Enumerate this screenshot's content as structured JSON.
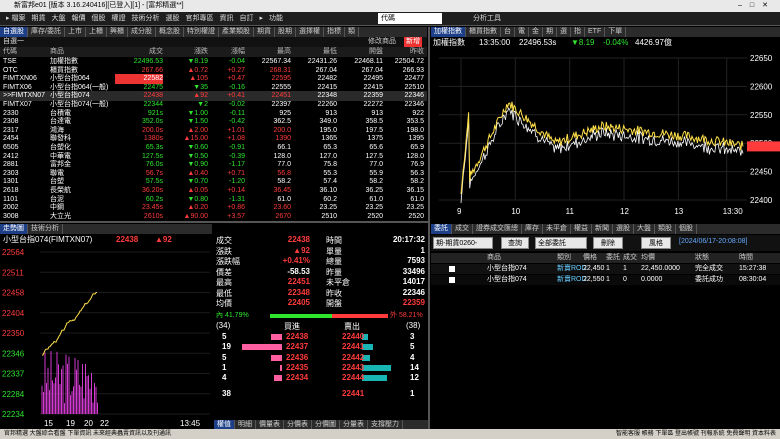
{
  "titlebar": {
    "text": "新富邦e01 [版本 3.16.240416][已登入][1] - [富邦精選**]"
  },
  "menu": {
    "items": [
      "▸ 檔案",
      "期貨",
      "大盤",
      "報價",
      "個股",
      "權證",
      "技術分析",
      "選股",
      "官邦專區",
      "資訊",
      "自訂",
      "▸",
      "功能"
    ],
    "symbol": "代碼 FIMTXN07.TF",
    "analysis": "分析工具"
  },
  "left_tabs": [
    "自選股",
    "庫存/委託",
    "上市",
    "上櫃",
    "興櫃",
    "成分股",
    "概念股",
    "特別權證",
    "產業類股",
    "期貨",
    "股期",
    "選擇權",
    "指標",
    "類"
  ],
  "sub": {
    "name": "自選一",
    "mode": "修改商品",
    "badge": "新增"
  },
  "quote_headers": [
    "代碼",
    "商品",
    "成交",
    "漲跌",
    "漲幅",
    "最高",
    "最低",
    "開盤",
    "昨收"
  ],
  "quotes": [
    {
      "code": "TSE",
      "name": "加權指數",
      "price": "22496.53",
      "chg": "▼8.19",
      "pct": "-0.04",
      "high": "22567.34",
      "low": "22431.26",
      "open": "22468.11",
      "prev": "22504.72",
      "c": "grn"
    },
    {
      "code": "OTC",
      "name": "櫃買指數",
      "price": "267.66",
      "chg": "▲0.72",
      "pct": "+0.27",
      "high": "268.31",
      "low": "267.04",
      "open": "267.04",
      "prev": "266.93",
      "c": "red"
    },
    {
      "code": "FIMTXN06",
      "name": "小型台指064",
      "price": "22582",
      "chg": "▲105",
      "pct": "+0.47",
      "high": "22595",
      "low": "22482",
      "open": "22495",
      "prev": "22477",
      "c": "red"
    },
    {
      "code": "FIMTX06",
      "name": "小型台指064(一般)",
      "price": "22475",
      "chg": "▼35",
      "pct": "-0.16",
      "high": "22555",
      "low": "22415",
      "open": "22415",
      "prev": "22510",
      "c": "grn"
    },
    {
      "code": ">>FIMTXN07",
      "name": "小型台指074",
      "price": "22438",
      "chg": "▲92",
      "pct": "+0.41",
      "high": "22451",
      "low": "22348",
      "open": "22359",
      "prev": "22346",
      "c": "red"
    },
    {
      "code": "FIMTX07",
      "name": "小型台指074(一般)",
      "price": "22344",
      "chg": "▼2",
      "pct": "-0.02",
      "high": "22397",
      "low": "22260",
      "open": "22272",
      "prev": "22346",
      "c": "grn"
    },
    {
      "code": "2330",
      "name": "台積電",
      "price": "921s",
      "chg": "▼1.00",
      "pct": "-0.11",
      "high": "925",
      "low": "913",
      "open": "913",
      "prev": "922",
      "c": "grn"
    },
    {
      "code": "2308",
      "name": "台達電",
      "price": "352.0s",
      "chg": "▼1.50",
      "pct": "-0.42",
      "high": "362.5",
      "low": "349.0",
      "open": "358.5",
      "prev": "353.5",
      "c": "grn"
    },
    {
      "code": "2317",
      "name": "鴻海",
      "price": "200.0s",
      "chg": "▲2.00",
      "pct": "+1.01",
      "high": "200.0",
      "low": "195.0",
      "open": "197.5",
      "prev": "198.0",
      "c": "red"
    },
    {
      "code": "2454",
      "name": "聯發科",
      "price": "1380s",
      "chg": "▲15.00",
      "pct": "+1.08",
      "high": "1390",
      "low": "1365",
      "open": "1375",
      "prev": "1395",
      "c": "red"
    },
    {
      "code": "6505",
      "name": "台塑化",
      "price": "65.3s",
      "chg": "▼0.60",
      "pct": "-0.91",
      "high": "66.1",
      "low": "65.3",
      "open": "65.6",
      "prev": "65.9",
      "c": "grn"
    },
    {
      "code": "2412",
      "name": "中華電",
      "price": "127.5s",
      "chg": "▼0.50",
      "pct": "-0.39",
      "high": "128.0",
      "low": "127.0",
      "open": "127.5",
      "prev": "128.0",
      "c": "grn"
    },
    {
      "code": "2881",
      "name": "富邦金",
      "price": "76.0s",
      "chg": "▼0.90",
      "pct": "-1.17",
      "high": "77.0",
      "low": "75.8",
      "open": "77.0",
      "prev": "76.9",
      "c": "grn"
    },
    {
      "code": "2303",
      "name": "聯電",
      "price": "56.7s",
      "chg": "▲0.40",
      "pct": "+0.71",
      "high": "56.8",
      "low": "55.3",
      "open": "55.9",
      "prev": "56.3",
      "c": "red"
    },
    {
      "code": "1301",
      "name": "台塑",
      "price": "57.5s",
      "chg": "▼0.70",
      "pct": "-1.20",
      "high": "58.2",
      "low": "57.4",
      "open": "58.2",
      "prev": "58.2",
      "c": "grn"
    },
    {
      "code": "2618",
      "name": "長榮航",
      "price": "36.20s",
      "chg": "▲0.05",
      "pct": "+0.14",
      "high": "36.45",
      "low": "36.10",
      "open": "36.25",
      "prev": "36.15",
      "c": "red"
    },
    {
      "code": "1101",
      "name": "台泥",
      "price": "60.2s",
      "chg": "▼0.80",
      "pct": "-1.31",
      "high": "61.0",
      "low": "60.2",
      "open": "61.0",
      "prev": "61.0",
      "c": "grn"
    },
    {
      "code": "2002",
      "name": "中鋼",
      "price": "23.45s",
      "chg": "▲0.20",
      "pct": "+0.86",
      "high": "23.60",
      "low": "23.25",
      "open": "23.25",
      "prev": "23.25",
      "c": "red"
    },
    {
      "code": "3008",
      "name": "大立光",
      "price": "2610s",
      "chg": "▲90.00",
      "pct": "+3.57",
      "high": "2670",
      "low": "2510",
      "open": "2520",
      "prev": "2520",
      "c": "red"
    }
  ],
  "detail_tabs": [
    "走勢圖",
    "技術分析"
  ],
  "detail": {
    "title": "小型台指074(FIMTXN07)",
    "price": "22438",
    "chg": "▲92",
    "y_labels": [
      "22564",
      "22511",
      "22458",
      "22404",
      "22350",
      "22346",
      "22337",
      "22284",
      "22234"
    ],
    "x_labels": [
      "15",
      "19",
      "20",
      "22",
      "13:45"
    ]
  },
  "stats": [
    [
      "成交",
      "22438",
      "時間",
      "20:17:32"
    ],
    [
      "漲跌",
      "▲92",
      "單量",
      "1"
    ],
    [
      "漲跌幅",
      "+0.41%",
      "總量",
      "7593"
    ],
    [
      "價差",
      "-58.53",
      "昨量",
      "33496"
    ],
    [
      "最高",
      "22451",
      "未平倉",
      "14017"
    ],
    [
      "最低",
      "22348",
      "昨收",
      "22346"
    ],
    [
      "均價",
      "22405",
      "開盤",
      "22359"
    ]
  ],
  "ratio": {
    "inner": "內 41.79%",
    "outer": "外 58.21%"
  },
  "book": {
    "bid_total": "(34)",
    "ask_total": "(38)",
    "bid_label": "買進",
    "ask_label": "賣出",
    "rows": [
      [
        "5",
        "22438",
        "22440",
        "3"
      ],
      [
        "19",
        "22437",
        "22441",
        "5"
      ],
      [
        "5",
        "22436",
        "22442",
        "4"
      ],
      [
        "1",
        "22435",
        "22443",
        "14"
      ],
      [
        "4",
        "22434",
        "22444",
        "12"
      ]
    ],
    "sum": [
      "38",
      "22441",
      "1"
    ]
  },
  "bottom_tabs": [
    "權值",
    "明細",
    "價量表",
    "分價表",
    "分價圖",
    "分量表",
    "支撐壓力"
  ],
  "chart_tabs": [
    "加權指數",
    "櫃買指數",
    "台",
    "電",
    "金",
    "期",
    "選",
    "指",
    "ETF",
    "下單"
  ],
  "chart_head": {
    "name": "加權指數",
    "time": "13:35:00",
    "price": "22496.53s",
    "chg": "▼8.19",
    "pct": "-0.04%",
    "vol": "4426.97億"
  },
  "chart_data": {
    "type": "line",
    "x": [
      "9",
      "10",
      "11",
      "12",
      "13",
      "13:30"
    ],
    "ylim": [
      22400,
      22650
    ],
    "yticks": [
      "22650",
      "22600",
      "22550",
      "22500",
      "22450",
      "22400"
    ],
    "series": [
      {
        "name": "",
        "values": [
          22410,
          22572,
          22500,
          22530,
          22520,
          22510,
          22495
        ]
      }
    ]
  },
  "order_tabs": [
    "委託",
    "成交",
    "證券成交匯總",
    "庫存",
    "未平倉",
    "權益",
    "新聞",
    "選股",
    "大盤",
    "類股",
    "個股"
  ],
  "order_bar": {
    "account": "期-期貨0260-",
    "query": "查詢",
    "filter": "全部委託",
    "delete": "刪除",
    "risk": "風格",
    "date": "[2024/06/17-20:08:08]"
  },
  "order_headers": [
    "商品",
    "類別",
    "價格",
    "委託",
    "成交",
    "均價",
    "狀態",
    "時間"
  ],
  "orders": [
    [
      "小型台指074",
      "新賣ROD",
      "22,450",
      "1",
      "1",
      "22,450.0000",
      "完全成交",
      "15:27:38"
    ],
    [
      "小型台指074",
      "新賣ROD",
      "22,550",
      "1",
      "0",
      "0.0000",
      "委託成功",
      "08:30:04"
    ]
  ],
  "statusbar": {
    "text": "官邦精選  大盤綜合看盤  下單資訊  未來經典蟲賣資訊以及刊通訊",
    "right": "智能客服  帳務  下單區  登出帳號  刊報系統  免費聲明  資本料表"
  }
}
